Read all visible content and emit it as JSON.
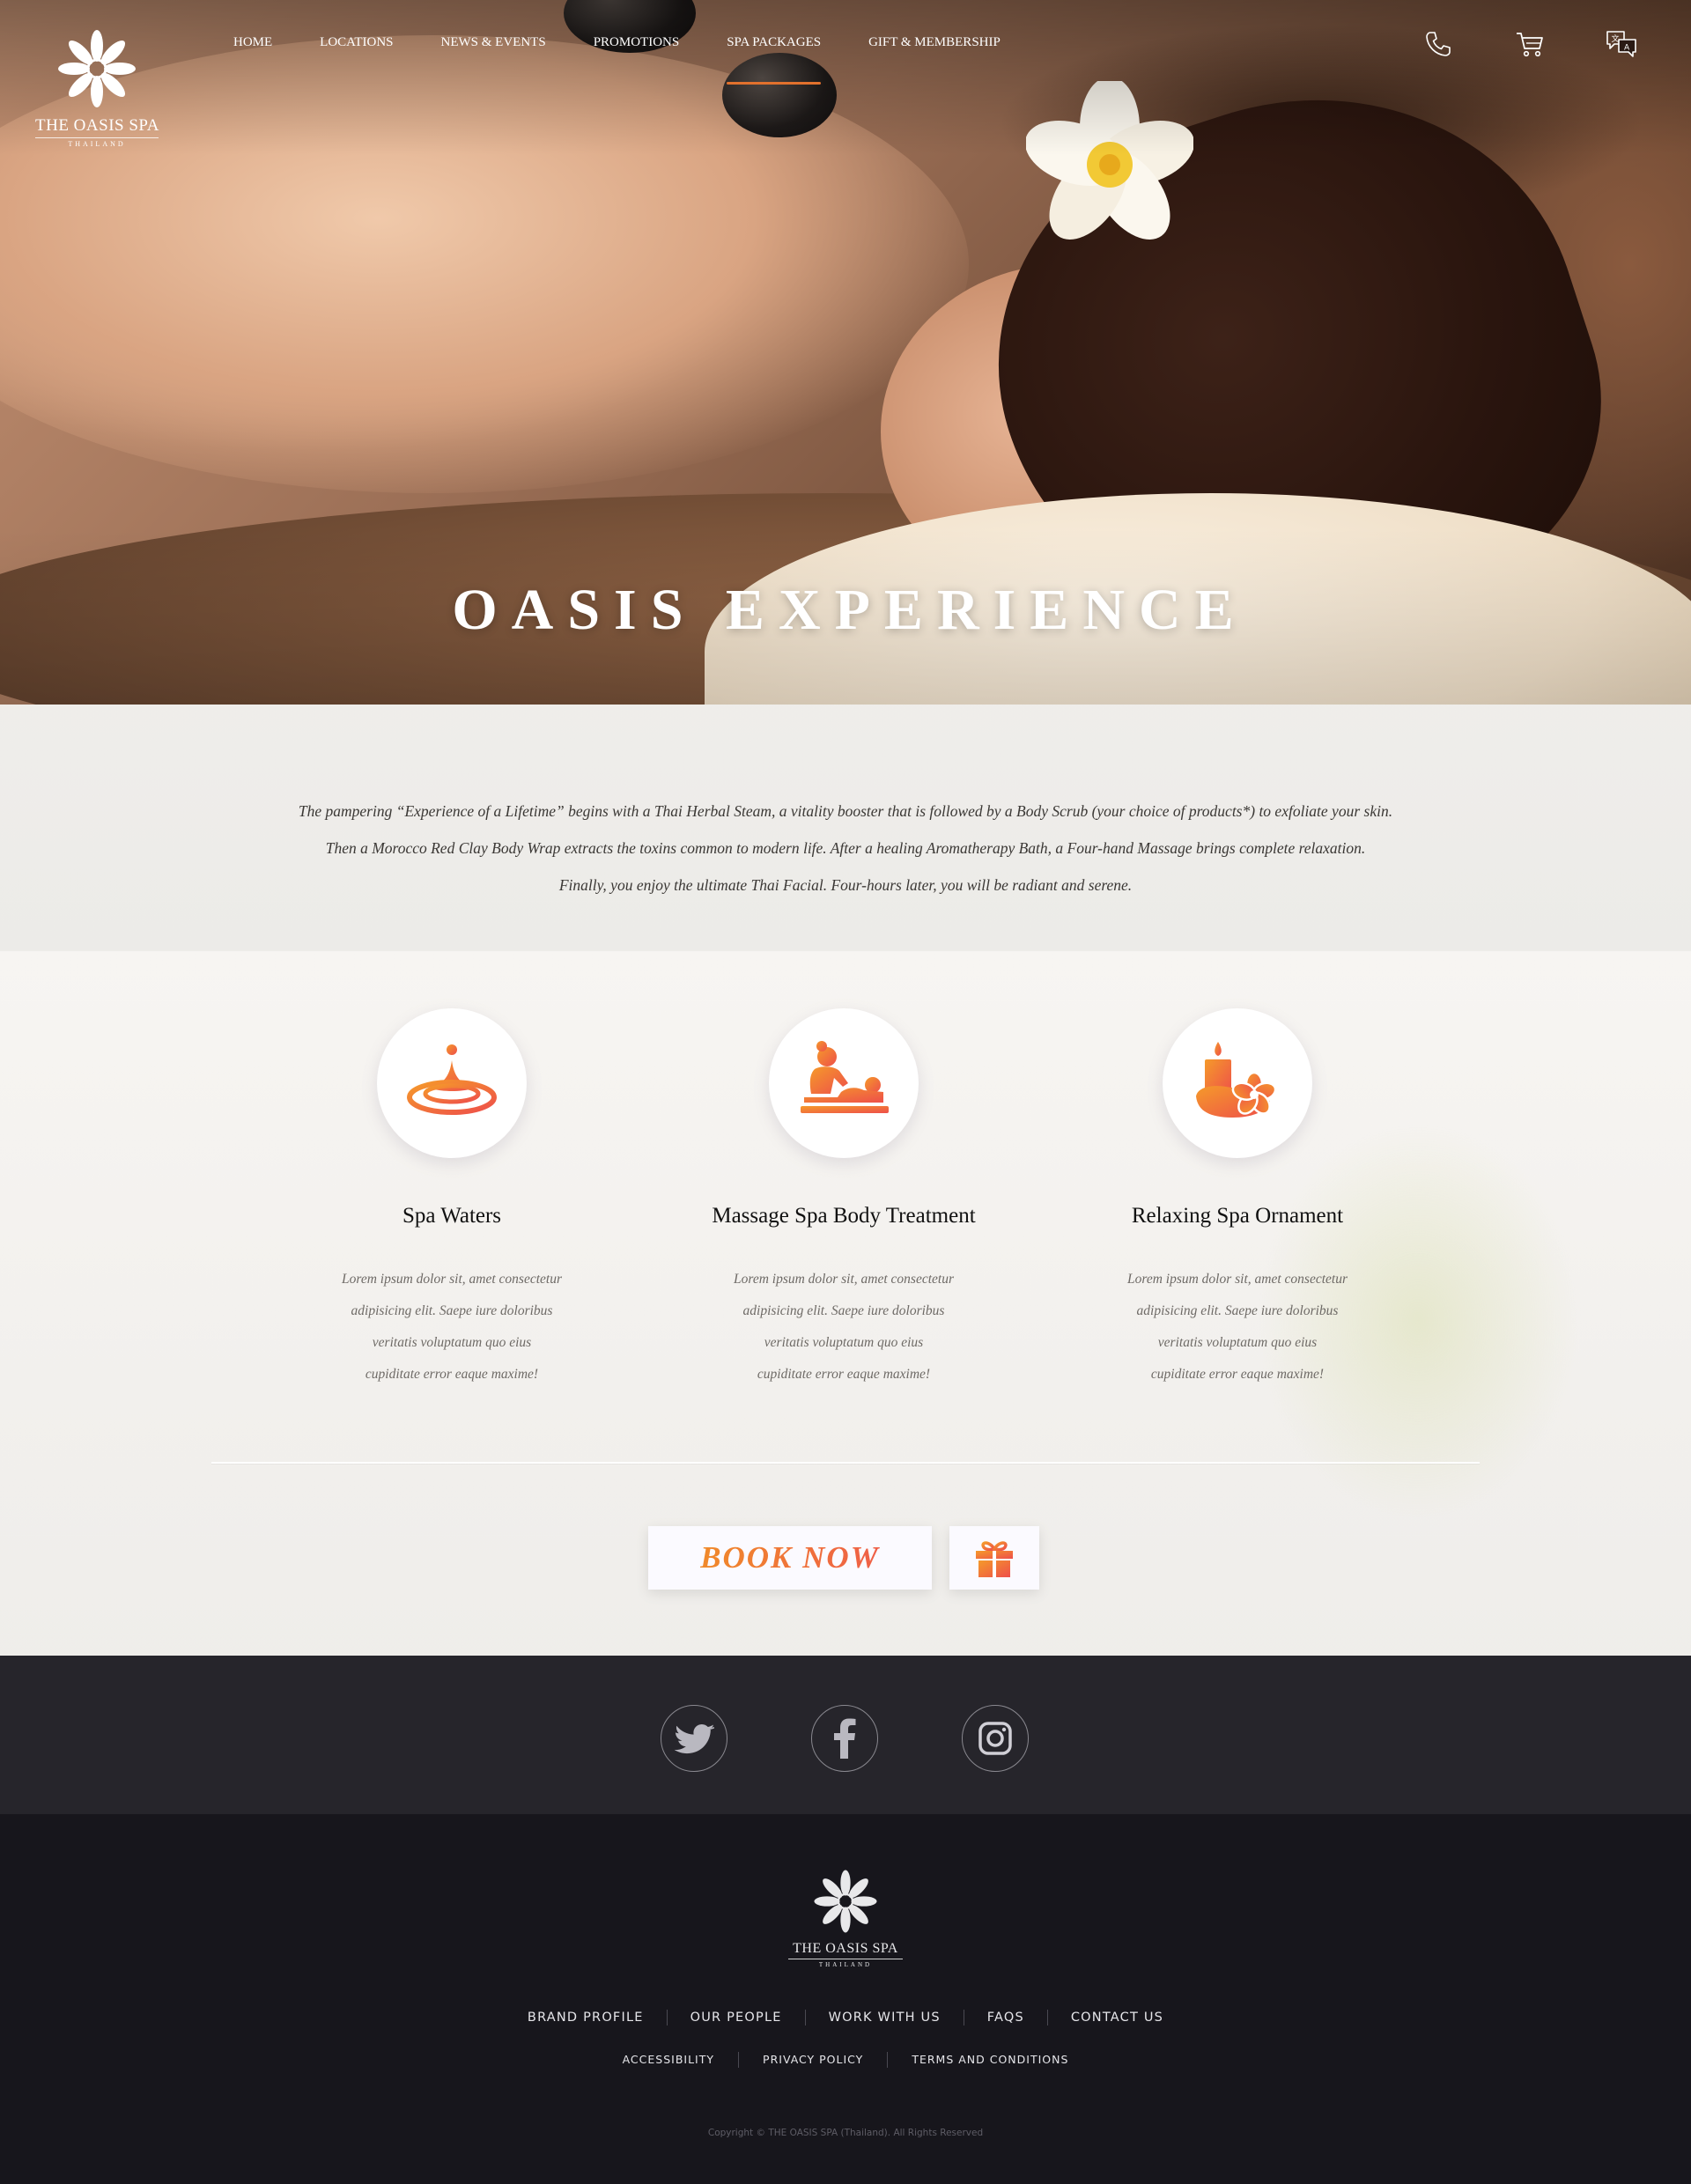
{
  "brand": {
    "name": "THE OASIS SPA",
    "sub": "THAILAND"
  },
  "nav": {
    "items": [
      {
        "label": "HOME",
        "active": false
      },
      {
        "label": "LOCATIONS",
        "active": false
      },
      {
        "label": "NEWS & EVENTS",
        "active": false
      },
      {
        "label": "PROMOTIONS",
        "active": false
      },
      {
        "label": "SPA PACKAGES",
        "active": true
      },
      {
        "label": "GIFT & MEMBERSHIP",
        "active": false
      }
    ],
    "icons": [
      "phone-icon",
      "cart-icon",
      "language-icon"
    ]
  },
  "hero": {
    "title": "OASIS EXPERIENCE"
  },
  "intro": {
    "lines": [
      "The pampering “Experience of a Lifetime” begins with a Thai Herbal Steam, a vitality booster that is followed by a Body Scrub (your choice of products*) to exfoliate your skin.",
      "Then a Morocco Red Clay Body Wrap extracts the toxins common to modern life. After a healing Aromatherapy Bath, a Four-hand Massage brings complete relaxation.",
      "Finally, you enjoy the ultimate Thai Facial. Four-hours later, you will be radiant and serene."
    ]
  },
  "features": [
    {
      "icon": "water-drop-icon",
      "title": "Spa Waters",
      "desc": [
        "Lorem ipsum dolor sit, amet consectetur",
        "adipisicing elit. Saepe iure doloribus",
        "veritatis voluptatum quo eius",
        "cupiditate error eaque maxime!"
      ]
    },
    {
      "icon": "massage-icon",
      "title": "Massage Spa Body Treatment",
      "desc": [
        "Lorem ipsum dolor sit, amet consectetur",
        "adipisicing elit. Saepe iure doloribus",
        "veritatis voluptatum quo eius",
        "cupiditate error eaque maxime!"
      ]
    },
    {
      "icon": "candle-flower-icon",
      "title": "Relaxing Spa Ornament",
      "desc": [
        "Lorem ipsum dolor sit, amet consectetur",
        "adipisicing elit. Saepe iure doloribus",
        "veritatis voluptatum quo eius",
        "cupiditate error eaque maxime!"
      ]
    }
  ],
  "cta": {
    "book_label": "BOOK NOW",
    "gift_icon": "gift-icon"
  },
  "social": [
    "twitter-icon",
    "facebook-icon",
    "instagram-icon"
  ],
  "footer": {
    "links": [
      "BRAND PROFILE",
      "OUR PEOPLE",
      "WORK WITH US",
      "FAQS",
      "CONTACT US"
    ],
    "small_links": [
      "ACCESSIBILITY",
      "PRIVACY POLICY",
      "TERMS AND CONDITIONS"
    ],
    "copyright": "Copyright © THE OASIS SPA (Thailand). All Rights Reserved"
  },
  "colors": {
    "accent_orange": "#f08a2a",
    "accent_red": "#ef5f47",
    "nav_underline": "#e2712d",
    "social_bg": "#26252b",
    "footer_bg": "#17161c"
  }
}
